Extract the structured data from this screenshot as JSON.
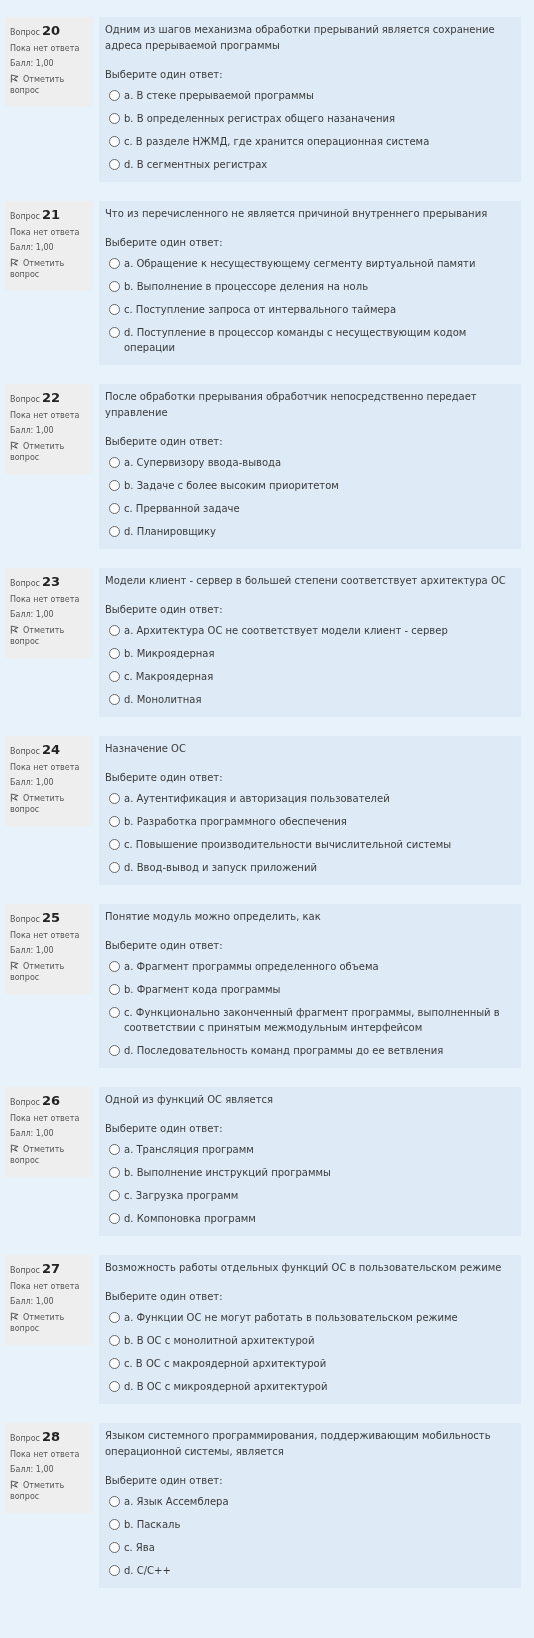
{
  "questions": [
    {
      "label": "Вопрос",
      "number": "20",
      "status": "Пока нет ответа",
      "grade": "Балл: 1,00",
      "flag": "Отметить вопрос",
      "text": "Одним из шагов механизма обработки прерываний является сохранение адреса прерываемой программы",
      "prompt": "Выберите один ответ:",
      "answers": [
        {
          "text": "a. В стеке прерываемой программы",
          "selected": false
        },
        {
          "text": "b. В определенных регистрах общего назаначения",
          "selected": false
        },
        {
          "text": "c. В разделе НЖМД, где хранится операционная система",
          "selected": false
        },
        {
          "text": "d. В сегментных регистрах",
          "selected": false
        }
      ]
    },
    {
      "label": "Вопрос",
      "number": "21",
      "status": "Пока нет ответа",
      "grade": "Балл: 1,00",
      "flag": "Отметить вопрос",
      "text": "Что из перечисленного не является причиной внутреннего прерывания",
      "prompt": "Выберите один ответ:",
      "answers": [
        {
          "text": "a. Обращение к несуществующему сегменту виртуальной памяти",
          "selected": false
        },
        {
          "text": "b. Выполнение в процессоре деления на ноль",
          "selected": false
        },
        {
          "text": "c. Поступление запроса от интервального таймера",
          "selected": false
        },
        {
          "text": "d. Поступление в процессор команды с несуществующим кодом операции",
          "selected": false
        }
      ]
    },
    {
      "label": "Вопрос",
      "number": "22",
      "status": "Пока нет ответа",
      "grade": "Балл: 1,00",
      "flag": "Отметить вопрос",
      "text": "После обработки прерывания обработчик непосредственно передает управление",
      "prompt": "Выберите один ответ:",
      "answers": [
        {
          "text": "a. Супервизору ввода-вывода",
          "selected": false
        },
        {
          "text": "b. Задаче с более высоким приоритетом",
          "selected": false
        },
        {
          "text": "c. Прерванной задаче",
          "selected": false
        },
        {
          "text": "d. Планировщику",
          "selected": false
        }
      ]
    },
    {
      "label": "Вопрос",
      "number": "23",
      "status": "Пока нет ответа",
      "grade": "Балл: 1,00",
      "flag": "Отметить вопрос",
      "text": "Модели клиент - сервер в большей степени соответствует архитектура ОС",
      "prompt": "Выберите один ответ:",
      "answers": [
        {
          "text": "a. Архитектура ОС не соответствует модели клиент - сервер",
          "selected": false
        },
        {
          "text": "b. Микроядерная",
          "selected": false
        },
        {
          "text": "c. Макроядерная",
          "selected": false
        },
        {
          "text": "d. Монолитная",
          "selected": false
        }
      ]
    },
    {
      "label": "Вопрос",
      "number": "24",
      "status": "Пока нет ответа",
      "grade": "Балл: 1,00",
      "flag": "Отметить вопрос",
      "text": "Назначение ОС",
      "prompt": "Выберите один ответ:",
      "answers": [
        {
          "text": "a. Аутентификация и авторизация пользователей",
          "selected": false
        },
        {
          "text": "b. Разработка программного обеспечения",
          "selected": false
        },
        {
          "text": "c. Повышение производительности вычислительной системы",
          "selected": false
        },
        {
          "text": "d. Ввод-вывод и запуск приложений",
          "selected": false
        }
      ]
    },
    {
      "label": "Вопрос",
      "number": "25",
      "status": "Пока нет ответа",
      "grade": "Балл: 1,00",
      "flag": "Отметить вопрос",
      "text": "Понятие модуль можно определить, как",
      "prompt": "Выберите один ответ:",
      "answers": [
        {
          "text": "a. Фрагмент программы определенного объема",
          "selected": false
        },
        {
          "text": "b. Фрагмент кода программы",
          "selected": false
        },
        {
          "text": "c. Функционально законченный фрагмент программы, выполненный в соответствии с принятым межмодульным интерфейсом",
          "selected": false
        },
        {
          "text": "d. Последовательность команд программы до ее ветвления",
          "selected": false
        }
      ]
    },
    {
      "label": "Вопрос",
      "number": "26",
      "status": "Пока нет ответа",
      "grade": "Балл: 1,00",
      "flag": "Отметить вопрос",
      "text": "Одной из функций ОС является",
      "prompt": "Выберите один ответ:",
      "answers": [
        {
          "text": "a. Трансляция программ",
          "selected": false
        },
        {
          "text": "b. Выполнение инструкций программы",
          "selected": false
        },
        {
          "text": "c. Загрузка программ",
          "selected": false
        },
        {
          "text": "d. Компоновка программ",
          "selected": false
        }
      ]
    },
    {
      "label": "Вопрос",
      "number": "27",
      "status": "Пока нет ответа",
      "grade": "Балл: 1,00",
      "flag": "Отметить вопрос",
      "text": "Возможность работы отдельных функций ОС в пользовательском режиме",
      "prompt": "Выберите один ответ:",
      "answers": [
        {
          "text": "a. Функции ОС не могут работать в пользовательском режиме",
          "selected": false
        },
        {
          "text": "b. В ОС с монолитной архитектурой",
          "selected": false
        },
        {
          "text": "c. В ОС с макроядерной архитектурой",
          "selected": false
        },
        {
          "text": "d. В ОС с микроядерной архитектурой",
          "selected": false
        }
      ]
    },
    {
      "label": "Вопрос",
      "number": "28",
      "status": "Пока нет ответа",
      "grade": "Балл: 1,00",
      "flag": "Отметить вопрос",
      "text": "Языком системного программирования, поддерживающим мобильность операционной системы, является",
      "prompt": "Выберите один ответ:",
      "answers": [
        {
          "text": "a. Язык Ассемблера",
          "selected": false
        },
        {
          "text": "b. Паскаль",
          "selected": false
        },
        {
          "text": "c. Ява",
          "selected": false
        },
        {
          "text": "d. C/C++",
          "selected": false
        }
      ]
    }
  ]
}
